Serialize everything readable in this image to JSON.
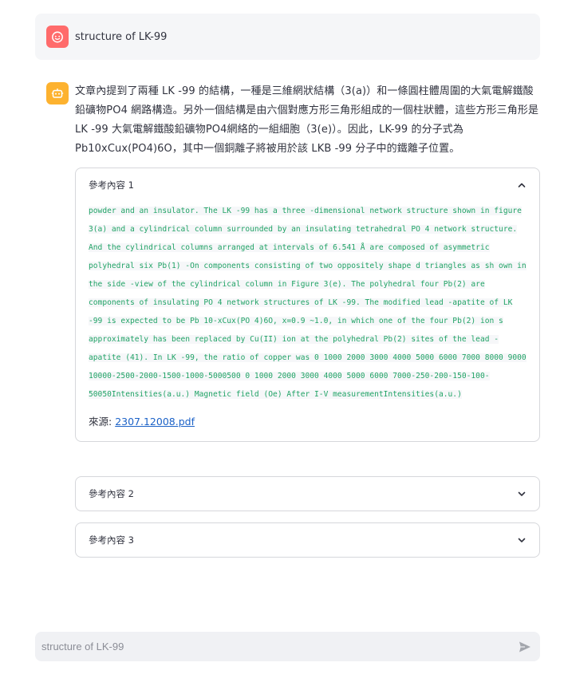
{
  "user_message": {
    "text": "structure of LK-99"
  },
  "assistant_message": {
    "text": "文章內提到了兩種 LK -99 的結構，一種是三維網狀結構（3(a)）和一條圓柱體周圍的大氣電解鐵酸鉛礦物PO4 網路構造。另外一個結構是由六個對應方形三角形組成的一個柱狀體，這些方形三角形是LK -99 大氣電解鐵酸鉛礦物PO4網絡的一組細胞（3(e)）。因此，LK-99 的分子式為 Pb10xCux(PO4)6O，其中一個銅離子將被用於該 LKB -99 分子中的鐵離子位置。"
  },
  "references": [
    {
      "title": "參考內容 1",
      "expanded": true,
      "content": " powder and an insulator. The LK -99 has a three -dimensional network structure shown in figure 3(a) and a cylindrical column surrounded by an insulating tetrahedral PO 4 network structure. And the cylindrical columns arranged at intervals of 6.541 Å are composed of asymmetric polyhedral six Pb(1) -On components consisting of two oppositely shape d triangles as sh own in the side -view of the cylindrical column in Figure 3(e). The polyhedral four Pb(2) are components of insulating PO 4 network structures of LK -99. The modified lead -apatite of LK -99 is expected to be Pb 10-xCux(PO 4)6O, x=0.9 ~1.0, in which one of the four Pb(2) ion s approximately has been replaced by Cu(II) ion at the polyhedral Pb(2) sites of the lead -apatite (41). In LK -99, the ratio of copper was 0 1000 2000 3000 4000 5000 6000 7000 8000 9000 10000-2500-2000-1500-1000-5000500 0 1000 2000 3000 4000 5000 6000 7000-250-200-150-100-50050Intensities(a.u.) Magnetic field (Oe) After I-V measurementIntensities(a.u.)",
      "source_label": "來源: ",
      "source_link": "2307.12008.pdf"
    },
    {
      "title": "參考內容 2",
      "expanded": false
    },
    {
      "title": "參考內容 3",
      "expanded": false
    }
  ],
  "chat_input": {
    "placeholder": "structure of LK-99"
  },
  "colors": {
    "user_avatar": "#ff6b6b",
    "bot_avatar": "#fdb22f",
    "code_text": "#21a366",
    "link": "#1c62c7"
  },
  "icons": {
    "user_avatar": "smiley-face-icon",
    "bot_avatar": "robot-icon",
    "collapse": "chevron-up-icon",
    "expand": "chevron-down-icon",
    "send": "send-icon"
  }
}
